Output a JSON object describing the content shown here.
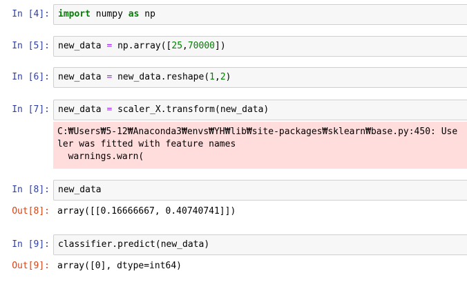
{
  "cells": [
    {
      "prompt": "In [4]:",
      "code": {
        "kw1": "import",
        "t1": " numpy ",
        "kw2": "as",
        "t2": " np"
      }
    },
    {
      "prompt": "In [5]:",
      "code": {
        "a": "new_data ",
        "eq": "=",
        "b": " np.array([",
        "n1": "25",
        "c": ",",
        "n2": "70000",
        "d": "])"
      }
    },
    {
      "prompt": "In [6]:",
      "code": {
        "a": "new_data ",
        "eq": "=",
        "b": " new_data.reshape(",
        "n1": "1",
        "c": ",",
        "n2": "2",
        "d": ")"
      }
    },
    {
      "prompt": "In [7]:",
      "code": {
        "a": "new_data ",
        "eq": "=",
        "b": " scaler_X.transform(new_data)"
      },
      "stderr": [
        "C:₩Users₩5-12₩Anaconda3₩envs₩YH₩lib₩site-packages₩sklearn₩base.py:450: Use",
        "ler was fitted with feature names",
        "  warnings.warn("
      ]
    },
    {
      "prompt": "In [8]:",
      "code": {
        "a": "new_data"
      },
      "out_prompt": "Out[8]:",
      "output": "array([[0.16666667, 0.40740741]])"
    },
    {
      "prompt": "In [9]:",
      "code": {
        "a": "classifier.predict(new_data)"
      },
      "out_prompt": "Out[9]:",
      "output": "array([0], dtype=int64)"
    }
  ]
}
